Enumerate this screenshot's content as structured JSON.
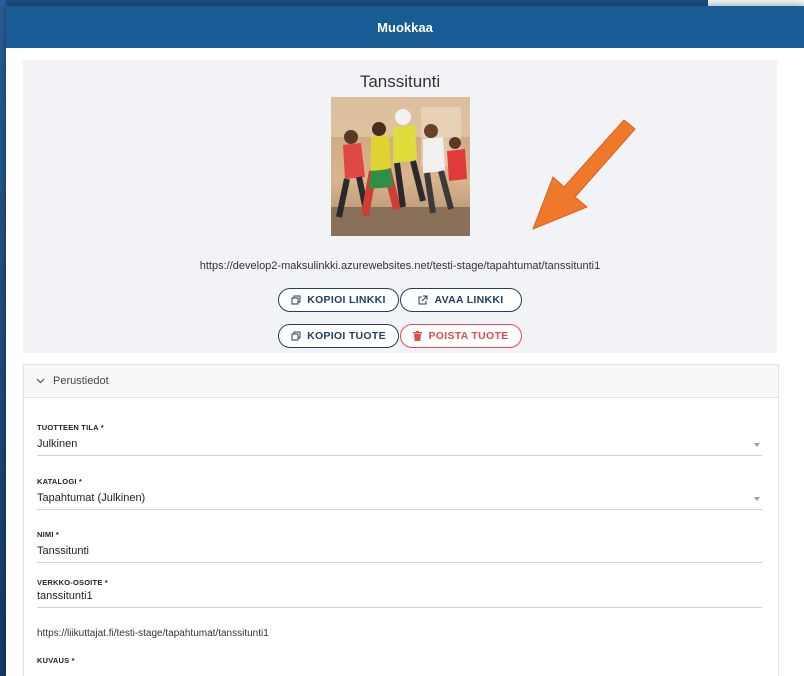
{
  "dialog": {
    "title": "Muokkaa"
  },
  "preview": {
    "title": "Tanssitunti",
    "image_alt": "dance-class-photo",
    "url": "https://develop2-maksulinkki.azurewebsites.net/testi-stage/tapahtumat/tanssitunti1",
    "buttons": {
      "copy_link": "KOPIOI LINKKI",
      "open_link": "AVAA LINKKI",
      "copy_product": "KOPIOI TUOTE",
      "delete_product": "POISTA TUOTE"
    }
  },
  "section": {
    "title": "Perustiedot",
    "fields": {
      "status": {
        "label": "TUOTTEEN TILA *",
        "value": "Julkinen"
      },
      "catalog": {
        "label": "KATALOGI *",
        "value": "Tapahtumat (Julkinen)"
      },
      "name": {
        "label": "NIMI *",
        "value": "Tanssitunti"
      },
      "web_address": {
        "label": "VERKKO-OSOITE *",
        "value": "tanssitunti1"
      },
      "description": {
        "label": "KUVAUS *"
      }
    },
    "public_url": "https://liikuttajat.fi/testi-stage/tapahtumat/tanssitunti1"
  },
  "colors": {
    "header": "#1a5c95",
    "accent": "#1f3f67",
    "danger": "#e04b50",
    "arrow": "#f0782a"
  }
}
